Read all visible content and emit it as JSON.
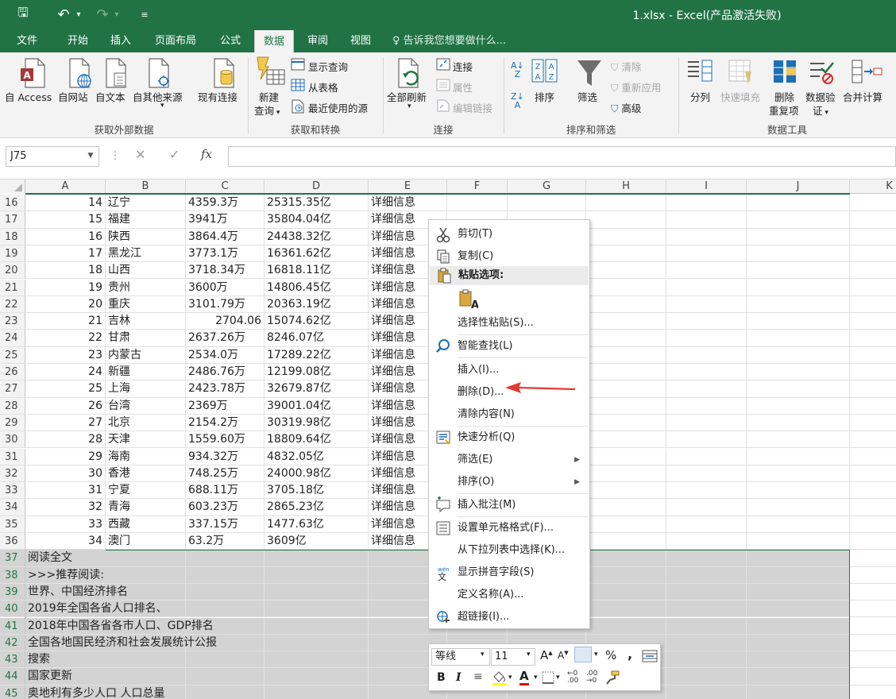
{
  "window": {
    "title": "1.xlsx - Excel(产品激活失败)",
    "qa_save": "🖫",
    "qa_undo": "↶",
    "qa_undo_dd": "▾",
    "qa_redo": "↷",
    "qa_redo_dd": "▾",
    "qa_customize": "≡"
  },
  "tabs": [
    "文件",
    "开始",
    "插入",
    "页面布局",
    "公式",
    "数据",
    "审阅",
    "视图"
  ],
  "tell_me": "告诉我您想要做什么...",
  "ribbon": {
    "get_external": {
      "access": "自 Access",
      "web": "自网站",
      "text": "自文本",
      "other": "自其他来源",
      "existing": "现有连接",
      "label": "获取外部数据"
    },
    "get_transform": {
      "new_query_1": "新建",
      "new_query_2": "查询",
      "show_queries": "显示查询",
      "from_table": "从表格",
      "recent_sources": "最近使用的源",
      "label": "获取和转换"
    },
    "connections": {
      "refresh_all": "全部刷新",
      "connections": "连接",
      "properties": "属性",
      "edit_links": "编辑链接",
      "label": "连接"
    },
    "sort_filter": {
      "sort": "排序",
      "filter": "筛选",
      "clear": "清除",
      "reapply": "重新应用",
      "advanced": "高级",
      "label": "排序和筛选"
    },
    "data_tools": {
      "text_to_columns": "分列",
      "flash_fill": "快速填充",
      "remove_dup_1": "删除",
      "remove_dup_2": "重复项",
      "validation_1": "数据验",
      "validation_2": "证",
      "consolidate": "合并计算",
      "label": "数据工具"
    }
  },
  "formula_bar": {
    "name_box": "J75",
    "fx": "fx",
    "cancel": "✕",
    "enter": "✓"
  },
  "columns": [
    "A",
    "B",
    "C",
    "D",
    "E",
    "F",
    "G",
    "H",
    "I",
    "J",
    "K"
  ],
  "rows": [
    {
      "n": "16",
      "a": "14",
      "b": "辽宁",
      "c": "4359.3万",
      "d": "25315.35亿",
      "e": "详细信息"
    },
    {
      "n": "17",
      "a": "15",
      "b": "福建",
      "c": "3941万",
      "d": "35804.04亿",
      "e": "详细信息"
    },
    {
      "n": "18",
      "a": "16",
      "b": "陕西",
      "c": "3864.4万",
      "d": "24438.32亿",
      "e": "详细信息"
    },
    {
      "n": "19",
      "a": "17",
      "b": "黑龙江",
      "c": "3773.1万",
      "d": "16361.62亿",
      "e": "详细信息"
    },
    {
      "n": "20",
      "a": "18",
      "b": "山西",
      "c": "3718.34万",
      "d": "16818.11亿",
      "e": "详细信息"
    },
    {
      "n": "21",
      "a": "19",
      "b": "贵州",
      "c": "3600万",
      "d": "14806.45亿",
      "e": "详细信息"
    },
    {
      "n": "22",
      "a": "20",
      "b": "重庆",
      "c": "3101.79万",
      "d": "20363.19亿",
      "e": "详细信息"
    },
    {
      "n": "23",
      "a": "21",
      "b": "吉林",
      "c": "2704.06",
      "d": "15074.62亿",
      "e": "详细信息"
    },
    {
      "n": "24",
      "a": "22",
      "b": "甘肃",
      "c": "2637.26万",
      "d": "8246.07亿",
      "e": "详细信息"
    },
    {
      "n": "25",
      "a": "23",
      "b": "内蒙古",
      "c": "2534.0万",
      "d": "17289.22亿",
      "e": "详细信息"
    },
    {
      "n": "26",
      "a": "24",
      "b": "新疆",
      "c": "2486.76万",
      "d": "12199.08亿",
      "e": "详细信息"
    },
    {
      "n": "27",
      "a": "25",
      "b": "上海",
      "c": "2423.78万",
      "d": "32679.87亿",
      "e": "详细信息"
    },
    {
      "n": "28",
      "a": "26",
      "b": "台湾",
      "c": "2369万",
      "d": "39001.04亿",
      "e": "详细信息"
    },
    {
      "n": "29",
      "a": "27",
      "b": "北京",
      "c": "2154.2万",
      "d": "30319.98亿",
      "e": "详细信息"
    },
    {
      "n": "30",
      "a": "28",
      "b": "天津",
      "c": "1559.60万",
      "d": "18809.64亿",
      "e": "详细信息"
    },
    {
      "n": "31",
      "a": "29",
      "b": "海南",
      "c": "934.32万",
      "d": "4832.05亿",
      "e": "详细信息"
    },
    {
      "n": "32",
      "a": "30",
      "b": "香港",
      "c": "748.25万",
      "d": "24000.98亿",
      "e": "详细信息"
    },
    {
      "n": "33",
      "a": "31",
      "b": "宁夏",
      "c": "688.11万",
      "d": "3705.18亿",
      "e": "详细信息"
    },
    {
      "n": "34",
      "a": "32",
      "b": "青海",
      "c": "603.23万",
      "d": "2865.23亿",
      "e": "详细信息"
    },
    {
      "n": "35",
      "a": "33",
      "b": "西藏",
      "c": "337.15万",
      "d": "1477.63亿",
      "e": "详细信息"
    },
    {
      "n": "36",
      "a": "34",
      "b": "澳门",
      "c": "63.2万",
      "d": "3609亿",
      "e": "详细信息"
    }
  ],
  "text_rows": [
    {
      "n": "37",
      "text": "阅读全文"
    },
    {
      "n": "38",
      "text": ">>>推荐阅读:"
    },
    {
      "n": "39",
      "text": "世界、中国经济排名"
    },
    {
      "n": "40",
      "text": "2019年全国各省人口排名、"
    },
    {
      "n": "41",
      "text": "2018年中国各省各市人口、GDP排名"
    },
    {
      "n": "42",
      "text": "全国各地国民经济和社会发展统计公报"
    },
    {
      "n": "43",
      "text": "搜索"
    },
    {
      "n": "44",
      "text": "国家更新"
    },
    {
      "n": "45",
      "text": "奥地利有多少人口 人口总量"
    }
  ],
  "context_menu": {
    "cut": "剪切(T)",
    "copy": "复制(C)",
    "paste_options": "粘贴选项:",
    "paste_special": "选择性粘贴(S)...",
    "smart_lookup": "智能查找(L)",
    "insert": "插入(I)...",
    "delete": "删除(D)...",
    "clear_contents": "清除内容(N)",
    "quick_analysis": "快速分析(Q)",
    "filter": "筛选(E)",
    "sort": "排序(O)",
    "insert_comment": "插入批注(M)",
    "format_cells": "设置单元格格式(F)...",
    "pick_from_list": "从下拉列表中选择(K)...",
    "phonetic": "显示拼音字段(S)",
    "define_name": "定义名称(A)...",
    "hyperlink": "超链接(I)...",
    "submenu_arrow": "▶"
  },
  "mini_toolbar": {
    "font": "等线",
    "size": "11",
    "bold": "B",
    "italic": "I",
    "percent": "%",
    "comma": ",",
    "grow": "A",
    "shrink": "A",
    "font_color": "A"
  },
  "colors": {
    "excel_green": "#217346",
    "arrow_red": "#e53935"
  }
}
